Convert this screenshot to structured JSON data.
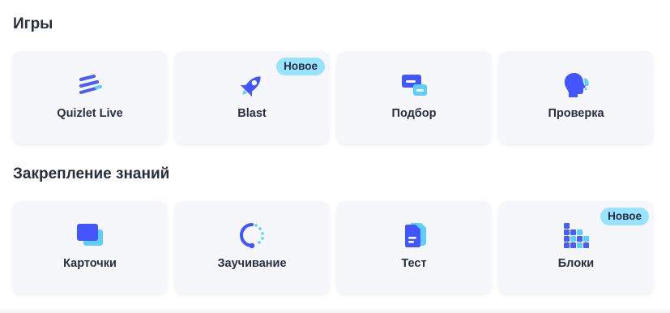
{
  "sections": {
    "games": {
      "title": "Игры",
      "cards": [
        {
          "label": "Quizlet Live",
          "icon": "quizlet-live-icon"
        },
        {
          "label": "Blast",
          "icon": "rocket-icon",
          "badge": "Новое"
        },
        {
          "label": "Подбор",
          "icon": "match-icon"
        },
        {
          "label": "Проверка",
          "icon": "checkpoint-head-icon"
        }
      ]
    },
    "study": {
      "title": "Закрепление знаний",
      "cards": [
        {
          "label": "Карточки",
          "icon": "flashcards-icon"
        },
        {
          "label": "Заучивание",
          "icon": "learn-cycle-icon"
        },
        {
          "label": "Тест",
          "icon": "test-document-icon"
        },
        {
          "label": "Блоки",
          "icon": "blocks-icon",
          "badge": "Новое"
        }
      ]
    }
  },
  "colors": {
    "primary": "#4255ff",
    "secondary": "#4b5cf7",
    "light_blue": "#5ccfff",
    "badge_bg": "#98e3ff",
    "card_bg": "#f6f7fb",
    "text": "#282e3e"
  }
}
